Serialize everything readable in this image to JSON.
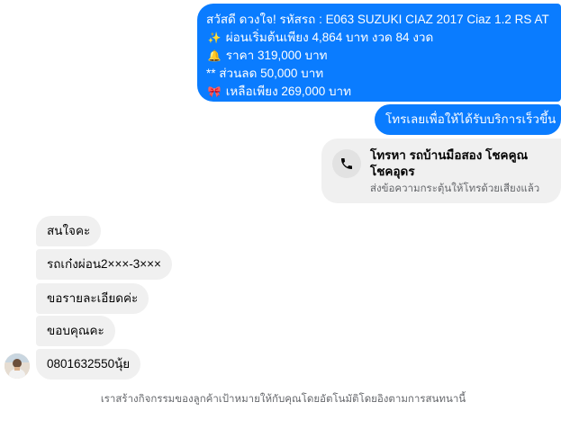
{
  "conversation": {
    "outgoing": [
      {
        "lines": [
          {
            "emoji": "",
            "text": "สวัสดี ดวงใจ!  รหัสรถ : E063 SUZUKI CIAZ 2017 Ciaz 1.2 RS AT"
          },
          {
            "emoji": "✨",
            "text": " ผ่อนเริ่มต้นเพียง 4,864 บาท งวด 84 งวด"
          },
          {
            "emoji": "🔔",
            "text": "  ราคา 319,000 บาท"
          },
          {
            "emoji": "",
            "text": "** ส่วนลด 50,000 บาท"
          },
          {
            "emoji": "🎀",
            "text": " เหลือเพียง 269,000 บาท"
          }
        ]
      },
      {
        "text": "โทรเลยเพื่อให้ได้รับบริการเร็วขึ้น"
      }
    ],
    "call_card": {
      "icon": "phone-icon",
      "title": "โทรหา รถบ้านมือสอง โชคคูณโชคอุดร",
      "subtitle": "ส่งข้อความกระตุ้นให้โทรด้วยเสียงแล้ว"
    },
    "incoming": [
      {
        "text": "สนใจคะ"
      },
      {
        "text": "รถเก๋งผ่อน2×××-3×××"
      },
      {
        "text": "ขอรายละเอียดค่ะ"
      },
      {
        "text": "ขอบคุณคะ"
      },
      {
        "text": "0801632550นุ้ย"
      }
    ],
    "footer": "เราสร้างกิจกรรมของลูกค้าเป้าหมายให้กับคุณโดยอัตโนมัติโดยอิงตามการสนทนานี้"
  },
  "colors": {
    "outgoing_bubble": "#0a7cff",
    "incoming_bubble": "#f0f0f0",
    "muted_text": "#65676b"
  }
}
